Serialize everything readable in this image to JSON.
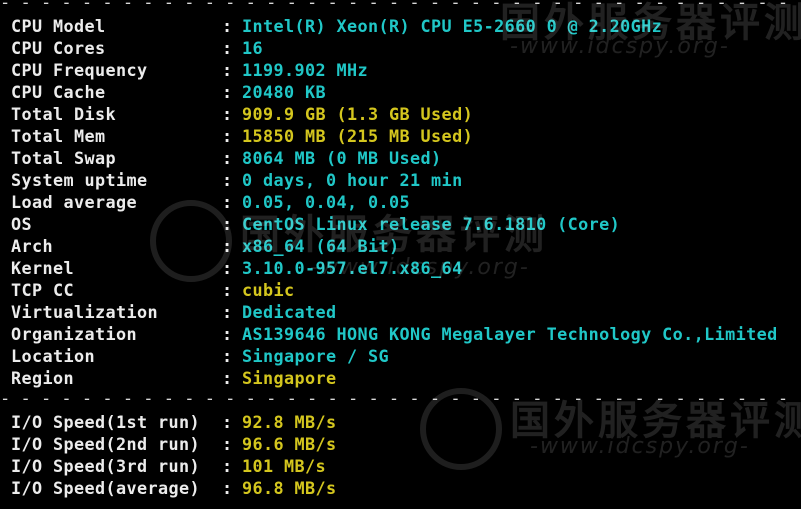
{
  "info": [
    {
      "label": "CPU Model",
      "value": "Intel(R) Xeon(R) CPU E5-2660 0 @ 2.20GHz",
      "color": "cyan"
    },
    {
      "label": "CPU Cores",
      "value": "16",
      "color": "cyan"
    },
    {
      "label": "CPU Frequency",
      "value": "1199.902 MHz",
      "color": "cyan"
    },
    {
      "label": "CPU Cache",
      "value": "20480 KB",
      "color": "cyan"
    },
    {
      "label": "Total Disk",
      "value": "909.9 GB (1.3 GB Used)",
      "color": "yellow"
    },
    {
      "label": "Total Mem",
      "value": "15850 MB (215 MB Used)",
      "color": "yellow"
    },
    {
      "label": "Total Swap",
      "value": "8064 MB (0 MB Used)",
      "color": "cyan"
    },
    {
      "label": "System uptime",
      "value": "0 days, 0 hour 21 min",
      "color": "cyan"
    },
    {
      "label": "Load average",
      "value": "0.05, 0.04, 0.05",
      "color": "cyan"
    },
    {
      "label": "OS",
      "value": "CentOS Linux release 7.6.1810 (Core)",
      "color": "cyan"
    },
    {
      "label": "Arch",
      "value": "x86_64 (64 Bit)",
      "color": "cyan"
    },
    {
      "label": "Kernel",
      "value": "3.10.0-957.el7.x86_64",
      "color": "cyan"
    },
    {
      "label": "TCP CC",
      "value": "cubic",
      "color": "yellow"
    },
    {
      "label": "Virtualization",
      "value": "Dedicated",
      "color": "cyan"
    },
    {
      "label": "Organization",
      "value": "AS139646 HONG KONG Megalayer Technology Co.,Limited",
      "color": "cyan"
    },
    {
      "label": "Location",
      "value": "Singapore / SG",
      "color": "cyan"
    },
    {
      "label": "Region",
      "value": "Singapore",
      "color": "yellow"
    }
  ],
  "io": [
    {
      "label": "I/O Speed(1st run)",
      "value": "92.8 MB/s",
      "color": "yellow"
    },
    {
      "label": "I/O Speed(2nd run)",
      "value": "96.6 MB/s",
      "color": "yellow"
    },
    {
      "label": "I/O Speed(3rd run)",
      "value": "101 MB/s",
      "color": "yellow"
    },
    {
      "label": "I/O Speed(average)",
      "value": "96.8 MB/s",
      "color": "yellow"
    }
  ],
  "separator": "- - - - - - - - - - - - - - - - - - - - - - - - - - - - - - - - - - - - - - - - - - - - - - - - - - - - - - - - - - - - - - - - - - - - - - - - -",
  "colon": ":",
  "watermark": {
    "title": "国外服务器评测",
    "url": "-www.idcspy.org-"
  },
  "colors": {
    "background": "#000000",
    "label": "#ececec",
    "cyan": "#20c7c7",
    "yellow": "#d4c61e"
  }
}
